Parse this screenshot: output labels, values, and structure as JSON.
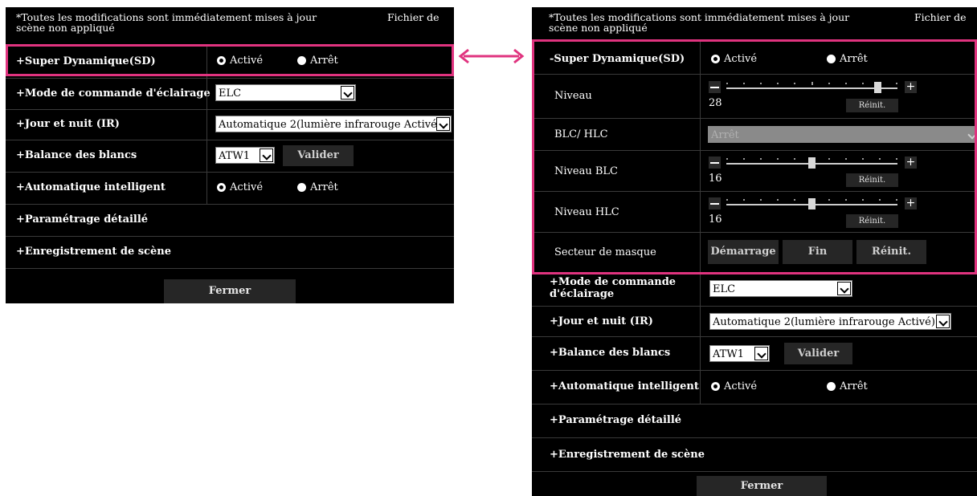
{
  "accent_color": "#e0337f",
  "left": {
    "header_note": "*Toutes les modifications sont immédiatement mises à jour scène non appliqué",
    "header_note_line1": "*Toutes les modifications sont immédiatement mises à jour",
    "header_note_line2": "scène non appliqué",
    "scene_label": "Fichier de",
    "rows": {
      "super_dynamic": {
        "label": "+Super Dynamique(SD)",
        "on": "Activé",
        "off": "Arrêt",
        "selected": "Activé"
      },
      "light_control": {
        "label": "+Mode de commande d'éclairage",
        "value": "ELC"
      },
      "day_night": {
        "label": "+Jour et nuit (IR)",
        "value": "Automatique 2(lumière infrarouge Activé)"
      },
      "white_balance": {
        "label": "+Balance des blancs",
        "value": "ATW1",
        "button": "Valider"
      },
      "intelligent_auto": {
        "label": "+Automatique intelligent",
        "on": "Activé",
        "off": "Arrêt",
        "selected": "Activé"
      },
      "detailed": {
        "label": "+Paramétrage détaillé"
      },
      "scene_save": {
        "label": "+Enregistrement de scène"
      }
    },
    "close": "Fermer"
  },
  "right": {
    "header_note_line1": "*Toutes les modifications sont immédiatement mises à jour",
    "header_note_line2": "scène non appliqué",
    "scene_label": "Fichier de",
    "rows": {
      "super_dynamic": {
        "label": "-Super Dynamique(SD)",
        "on": "Activé",
        "off": "Arrêt",
        "selected": "Activé"
      },
      "level": {
        "label": "Niveau",
        "value": "28",
        "reset": "Réinit.",
        "position": 0.9
      },
      "blc_hlc": {
        "label": "BLC/ HLC",
        "value": "Arrêt"
      },
      "blc_level": {
        "label": "Niveau BLC",
        "value": "16",
        "reset": "Réinit.",
        "position": 0.5
      },
      "hlc_level": {
        "label": "Niveau HLC",
        "value": "16",
        "reset": "Réinit.",
        "position": 0.5
      },
      "mask_area": {
        "label": "Secteur de masque",
        "start": "Démarrage",
        "end": "Fin",
        "reset": "Réinit."
      },
      "light_control": {
        "label_line1": "+Mode de commande",
        "label_line2": "d'éclairage",
        "value": "ELC"
      },
      "day_night": {
        "label": "+Jour et nuit (IR)",
        "value": "Automatique 2(lumière infrarouge Activé)"
      },
      "white_balance": {
        "label": "+Balance des blancs",
        "value": "ATW1",
        "button": "Valider"
      },
      "intelligent_auto": {
        "label": "+Automatique intelligent",
        "on": "Activé",
        "off": "Arrêt",
        "selected": "Activé"
      },
      "detailed": {
        "label": "+Paramétrage détaillé"
      },
      "scene_save": {
        "label": "+Enregistrement de scène"
      }
    },
    "close": "Fermer"
  }
}
